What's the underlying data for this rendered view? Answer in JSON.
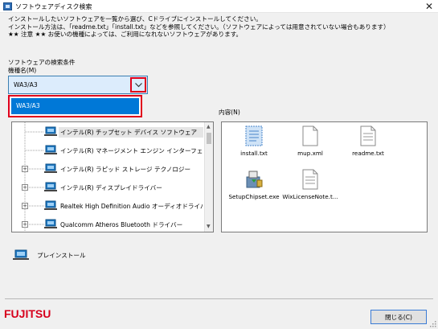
{
  "window": {
    "title": "ソフトウェアディスク検索",
    "close_glyph": "✕"
  },
  "intro": {
    "line1": "インストールしたいソフトウェアを一覧から選び、Cドライブにインストールしてください。",
    "line2": "インストール方法は、「readme.txt」「install.txt」などを参照してください。（ソフトウェアによっては用意されていない場合もあります）",
    "line3": "★★ 注意 ★★ お使いの機種によっては、ご利用になれないソフトウェアがあります。"
  },
  "search": {
    "conditions_label": "ソフトウェアの検索条件",
    "model_label": "機種名(M)",
    "model_value": "WA3/A3",
    "options": [
      "WA3/A3"
    ]
  },
  "content_label": "内容(N)",
  "tree": {
    "items": [
      {
        "label": "インテル(R) チップセット デバイス ソフトウェア",
        "expandable": false,
        "selected": true
      },
      {
        "label": "インテル(R) マネージメント エンジン インターフェイス",
        "expandable": false,
        "selected": false
      },
      {
        "label": "インテル(R) ラピッド ストレージ テクノロジー",
        "expandable": true,
        "selected": false
      },
      {
        "label": "インテル(R) ディスプレイドライバー",
        "expandable": true,
        "selected": false
      },
      {
        "label": "Realtek High Definition Audio オーディオドライバー",
        "expandable": true,
        "selected": false
      },
      {
        "label": "Qualcomm Atheros Bluetooth ドライバー",
        "expandable": true,
        "selected": false
      }
    ],
    "expander_glyph": "+",
    "scroll_up_glyph": "▲",
    "scroll_down_glyph": "▼"
  },
  "files": [
    {
      "name": "install.txt",
      "icon": "text-file-selected-icon"
    },
    {
      "name": "mup.xml",
      "icon": "document-icon"
    },
    {
      "name": "readme.txt",
      "icon": "text-file-icon"
    },
    {
      "name": "SetupChipset.exe",
      "icon": "installer-icon"
    },
    {
      "name": "WixLicenseNote.t...",
      "icon": "text-file-icon"
    }
  ],
  "preinstall": {
    "label": "プレインストール"
  },
  "footer": {
    "logo": "FUJITSU",
    "close_button": "閉じる(C)"
  },
  "colors": {
    "highlight_red": "#e0001b",
    "selection_blue": "#0078d7",
    "combo_bg": "#dcecfc",
    "logo_red": "#d7001c"
  }
}
